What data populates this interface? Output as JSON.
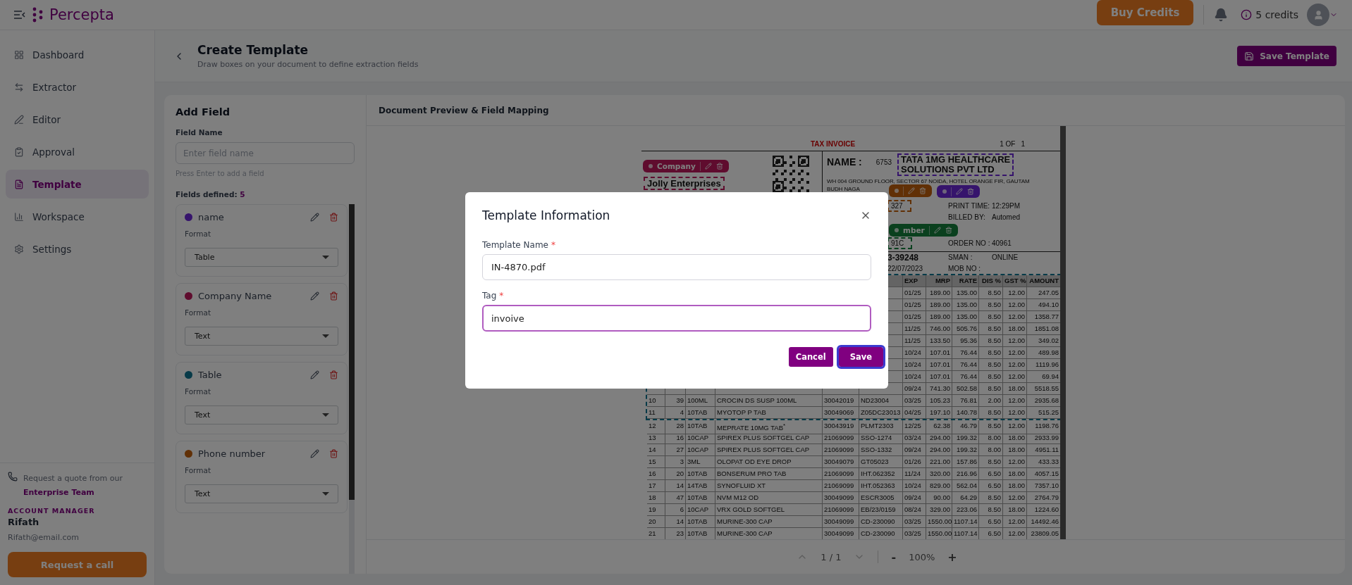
{
  "topbar": {
    "brand": "Percepta",
    "buy_button": "Buy Credits",
    "credits": "5 credits"
  },
  "sidebar": {
    "items": [
      {
        "label": "Dashboard",
        "selected": false
      },
      {
        "label": "Extractor",
        "selected": false
      },
      {
        "label": "Editor",
        "selected": false
      },
      {
        "label": "Approval",
        "selected": false
      },
      {
        "label": "Template",
        "selected": true
      },
      {
        "label": "Workspace",
        "selected": false
      },
      {
        "label": "Settings",
        "selected": false
      }
    ],
    "quote_text": "Request a quote from our",
    "quote_link": "Enterprise Team",
    "manager_heading": "ACCOUNT MANAGER",
    "manager_name": "Rifath",
    "manager_email": "Rifath@email.com",
    "call_button": "Request a call"
  },
  "page": {
    "title": "Create Template",
    "subtitle": "Draw boxes on your document to define extraction fields",
    "save_button": "Save Template"
  },
  "add_field": {
    "title": "Add Field",
    "field_label": "Field Name",
    "placeholder": "Enter field name",
    "hint": "Press Enter to add a field",
    "count_label": "Fields defined:",
    "count": "5",
    "fields": [
      {
        "name": "name",
        "color": "#36146c",
        "format_label": "Format",
        "format": "Table"
      },
      {
        "name": "Company Name",
        "color": "#5f0c2e",
        "format_label": "Format",
        "format": "Text"
      },
      {
        "name": "Table",
        "color": "#073a48",
        "format_label": "Format",
        "format": "Text"
      },
      {
        "name": "Phone number",
        "color": "#613006",
        "format_label": "Format",
        "format": "Text"
      }
    ]
  },
  "preview": {
    "title": "Document Preview & Field Mapping",
    "page_indicator": "1 / 1",
    "zoom_out": "-",
    "zoom": "100%",
    "zoom_in": "+",
    "document": {
      "title": "TAX INVOICE",
      "page_label": "1 OF",
      "page_number": "1",
      "supplier": {
        "text": "Jolly Enterprises",
        "color": "#5f0c2e"
      },
      "name_label": "NAME :",
      "name_code": "6753",
      "name_value": {
        "lines": [
          "TATA 1MG HEALTHCARE",
          "SOLUTIONS PVT LTD"
        ],
        "color": "#36146c"
      },
      "address_lines": [
        "WH 004 GROUND FLOOR, SECTOR 67 NOIDA, HOTEL ORANGE FIR, GAUTAM",
        "BUDH NAGA"
      ],
      "info_rows": [
        {
          "value": "327",
          "color": "#613006",
          "label": "PRINT TIME:",
          "detail": "12:29PM"
        },
        {
          "label": "BILLED BY:",
          "detail": "Automed"
        },
        {
          "value": "91C",
          "color": "#0a401e",
          "label": "ORDER NO :",
          "detail": "40961"
        },
        {
          "value": "3-39248",
          "bold": true,
          "label": "SMAN :",
          "detail": "ONLINE"
        },
        {
          "value": "22/07/2023",
          "bold": false,
          "label": "MOB NO :"
        }
      ],
      "field_tags": [
        {
          "label": "Company",
          "color": "#5f0c2e"
        },
        {
          "color": "#36146c"
        },
        {
          "color": "#613006"
        },
        {
          "label": "mber",
          "color": "#0a401e"
        }
      ],
      "table": {
        "color": "#073a48",
        "columns": [
          "EXP",
          "MRP",
          "RATE",
          "DIS %",
          "GST %",
          "AMOUNT"
        ],
        "selected_rows": [
          [
            "01/25",
            "189.00",
            "135.00",
            "8.50",
            "12.00",
            "247.05"
          ],
          [
            "01/25",
            "189.00",
            "135.00",
            "8.50",
            "12.00",
            "494.10"
          ],
          [
            "01/25",
            "189.00",
            "135.00",
            "8.50",
            "12.00",
            "1358.77"
          ],
          [
            "11/25",
            "746.00",
            "505.76",
            "8.50",
            "18.00",
            "1851.08"
          ],
          [
            "11/25",
            "133.50",
            "95.36",
            "8.50",
            "12.00",
            "349.02"
          ],
          [
            "10/24",
            "107.01",
            "76.44",
            "8.50",
            "12.00",
            "489.98"
          ],
          [
            "10/24",
            "107.01",
            "76.44",
            "8.50",
            "12.00",
            "1119.96"
          ],
          [
            "10/24",
            "107.01",
            "76.44",
            "8.50",
            "12.00",
            "69.94"
          ],
          [
            "09/24",
            "741.30",
            "502.58",
            "8.50",
            "18.00",
            "5518.55"
          ],
          [
            "10",
            "39",
            "100ML",
            "CROCIN DS SUSP 100ML",
            "30042019",
            "ND23004",
            "03/25",
            "105.23",
            "76.81",
            "2.00",
            "12.00",
            "2935.68"
          ],
          [
            "11",
            "4",
            "10TAB",
            "MYOTOP P TAB",
            "30049069",
            "Z05DC23013",
            "04/25",
            "197.10",
            "140.78",
            "8.50",
            "12.00",
            "515.25"
          ]
        ],
        "other_rows": [
          [
            "12",
            "28",
            "10TAB",
            "MEPRATE 10MG TAB$^{*}$",
            "30043919",
            "PLMT2303",
            "12/25",
            "62.38",
            "46.79",
            "8.50",
            "12.00",
            "1198.76"
          ],
          [
            "13",
            "16",
            "10CAP",
            "SPIREX PLUS SOFTGEL CAP",
            "21069099",
            "SSO-1274",
            "03/24",
            "294.00",
            "199.32",
            "8.00",
            "18.00",
            "2933.99"
          ],
          [
            "14",
            "27",
            "10CAP",
            "SPIREX PLUS SOFTGEL CAP",
            "21069099",
            "SSO-1332",
            "09/24",
            "294.00",
            "199.32",
            "8.00",
            "18.00",
            "4951.11"
          ],
          [
            "15",
            "3",
            "3ML",
            "OLOPAT OD EYE DROP",
            "30049079",
            "GT05023",
            "01/26",
            "221.00",
            "157.86",
            "8.50",
            "12.00",
            "433.33"
          ],
          [
            "16",
            "20",
            "10TAB",
            "BONSERUM PRO TAB",
            "21069099",
            "IHT.062352",
            "11/24",
            "320.00",
            "216.96",
            "6.50",
            "18.00",
            "4057.15"
          ],
          [
            "17",
            "14",
            "14TAB",
            "SYNOFLUID XT",
            "21069099",
            "IHT.052363",
            "10/24",
            "829.00",
            "562.04",
            "6.50",
            "18.00",
            "7357.10"
          ],
          [
            "18",
            "47",
            "10TAB",
            "NVM  M12 OD",
            "30049099",
            "ESCR3005",
            "09/24",
            "90.00",
            "64.29",
            "8.50",
            "12.00",
            "2764.79"
          ],
          [
            "19",
            "6",
            "10CAP",
            "VRX GOLD SOFTGEL",
            "21069099",
            "EB/23/0159",
            "08/24",
            "329.00",
            "223.06",
            "8.50",
            "18.00",
            "1224.60"
          ],
          [
            "20",
            "14",
            "10TAB",
            "MURINE-300 CAP",
            "30049099",
            "CD-230090",
            "03/25",
            "1550.00",
            "1107.14",
            "6.50",
            "12.00",
            "14492.46"
          ],
          [
            "21",
            "23",
            "10TAB",
            "MURINE-300 CAP",
            "30049099",
            "CD-230090",
            "03/25",
            "1550.00",
            "1107.14",
            "6.50",
            "12.00",
            "23809.05"
          ]
        ]
      }
    }
  },
  "modal": {
    "title": "Template Information",
    "fields": [
      {
        "label": "Template Name",
        "required_mark": "*",
        "value": "IN-4870.pdf",
        "focused": false
      },
      {
        "label": "Tag",
        "required_mark": "*",
        "value": "invoive",
        "focused": true
      }
    ],
    "cancel_button": "Cancel",
    "save_button": "Save",
    "save_focused": true
  }
}
